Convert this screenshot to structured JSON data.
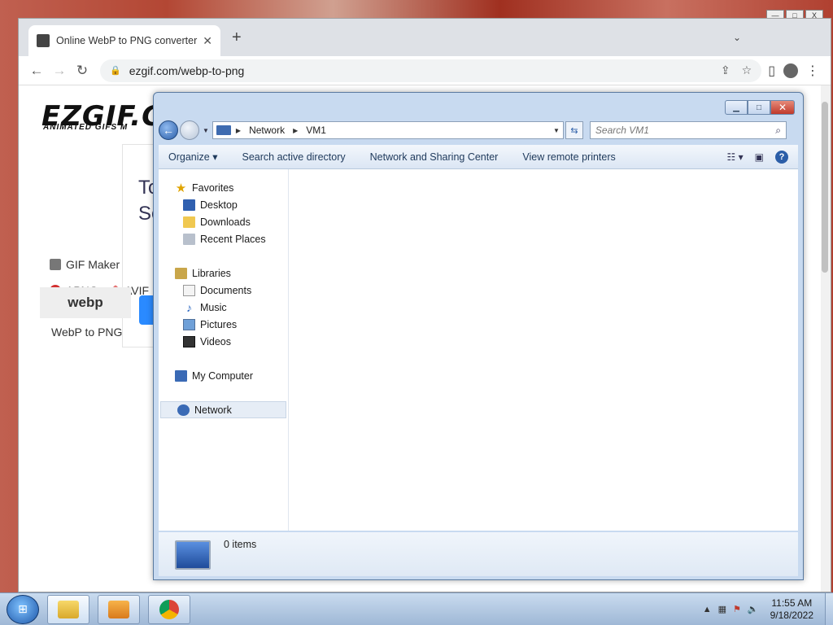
{
  "host": {
    "controls": [
      "—",
      "□",
      "X"
    ]
  },
  "chrome": {
    "tab_title": "Online WebP to PNG converter",
    "url": "ezgif.com/webp-to-png"
  },
  "page": {
    "logo": "EZGIF.C",
    "logo_sub": "ANIMATED GIFS M",
    "card_text_1": "To",
    "card_text_2": "Se",
    "tools": [
      "GIF Maker",
      "APNG",
      "AVIF"
    ],
    "webp_logo": "webp",
    "webp_label": "WebP to PNG"
  },
  "explorer": {
    "breadcrumb": [
      "Network",
      "VM1"
    ],
    "search_placeholder": "Search VM1",
    "commands": [
      "Organize",
      "Search active directory",
      "Network and Sharing Center",
      "View remote printers"
    ],
    "nav": {
      "favorites": {
        "label": "Favorites",
        "items": [
          "Desktop",
          "Downloads",
          "Recent Places"
        ]
      },
      "libraries": {
        "label": "Libraries",
        "items": [
          "Documents",
          "Music",
          "Pictures",
          "Videos"
        ]
      },
      "computer": "My Computer",
      "network": "Network"
    },
    "item_count": "0 items"
  },
  "taskbar": {
    "time": "11:55 AM",
    "date": "9/18/2022"
  }
}
